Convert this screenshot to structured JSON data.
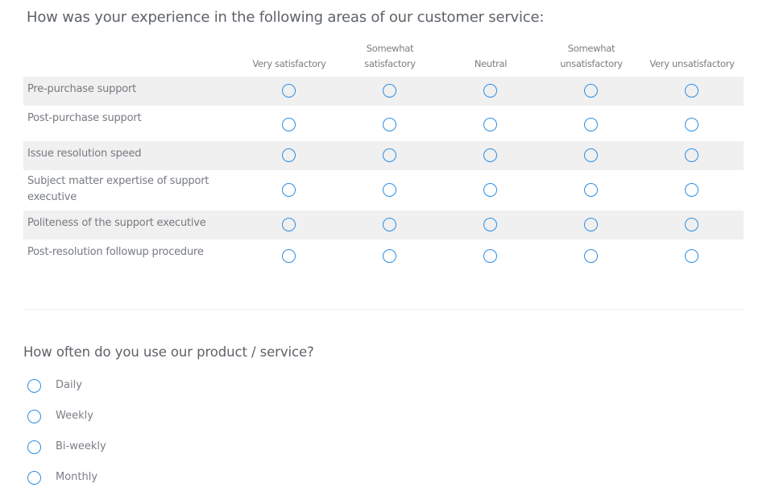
{
  "question1": {
    "title": "How was your experience in the following areas of our customer service:",
    "columns": [
      {
        "line1": "",
        "line2": "Very satisfactory"
      },
      {
        "line1": "Somewhat",
        "line2": "satisfactory"
      },
      {
        "line1": "",
        "line2": "Neutral"
      },
      {
        "line1": "Somewhat",
        "line2": "unsatisfactory"
      },
      {
        "line1": "",
        "line2": "Very unsatisfactory"
      }
    ],
    "rows": [
      {
        "label": "Pre-purchase support",
        "selected": null
      },
      {
        "label": "Post-purchase support",
        "selected": null
      },
      {
        "label": "Issue resolution speed",
        "selected": null
      },
      {
        "label": "Subject matter expertise of support executive",
        "selected": null
      },
      {
        "label": "Politeness of the support executive",
        "selected": null
      },
      {
        "label": "Post-resolution followup procedure",
        "selected": null
      }
    ]
  },
  "question2": {
    "title": "How often do you use our product / service?",
    "options": [
      "Daily",
      "Weekly",
      "Bi-weekly",
      "Monthly"
    ],
    "selected": null
  },
  "colors": {
    "accent": "#2d8ee3",
    "row_shade": "#f0f0f0",
    "text": "#767a80",
    "divider": "#ececec"
  }
}
